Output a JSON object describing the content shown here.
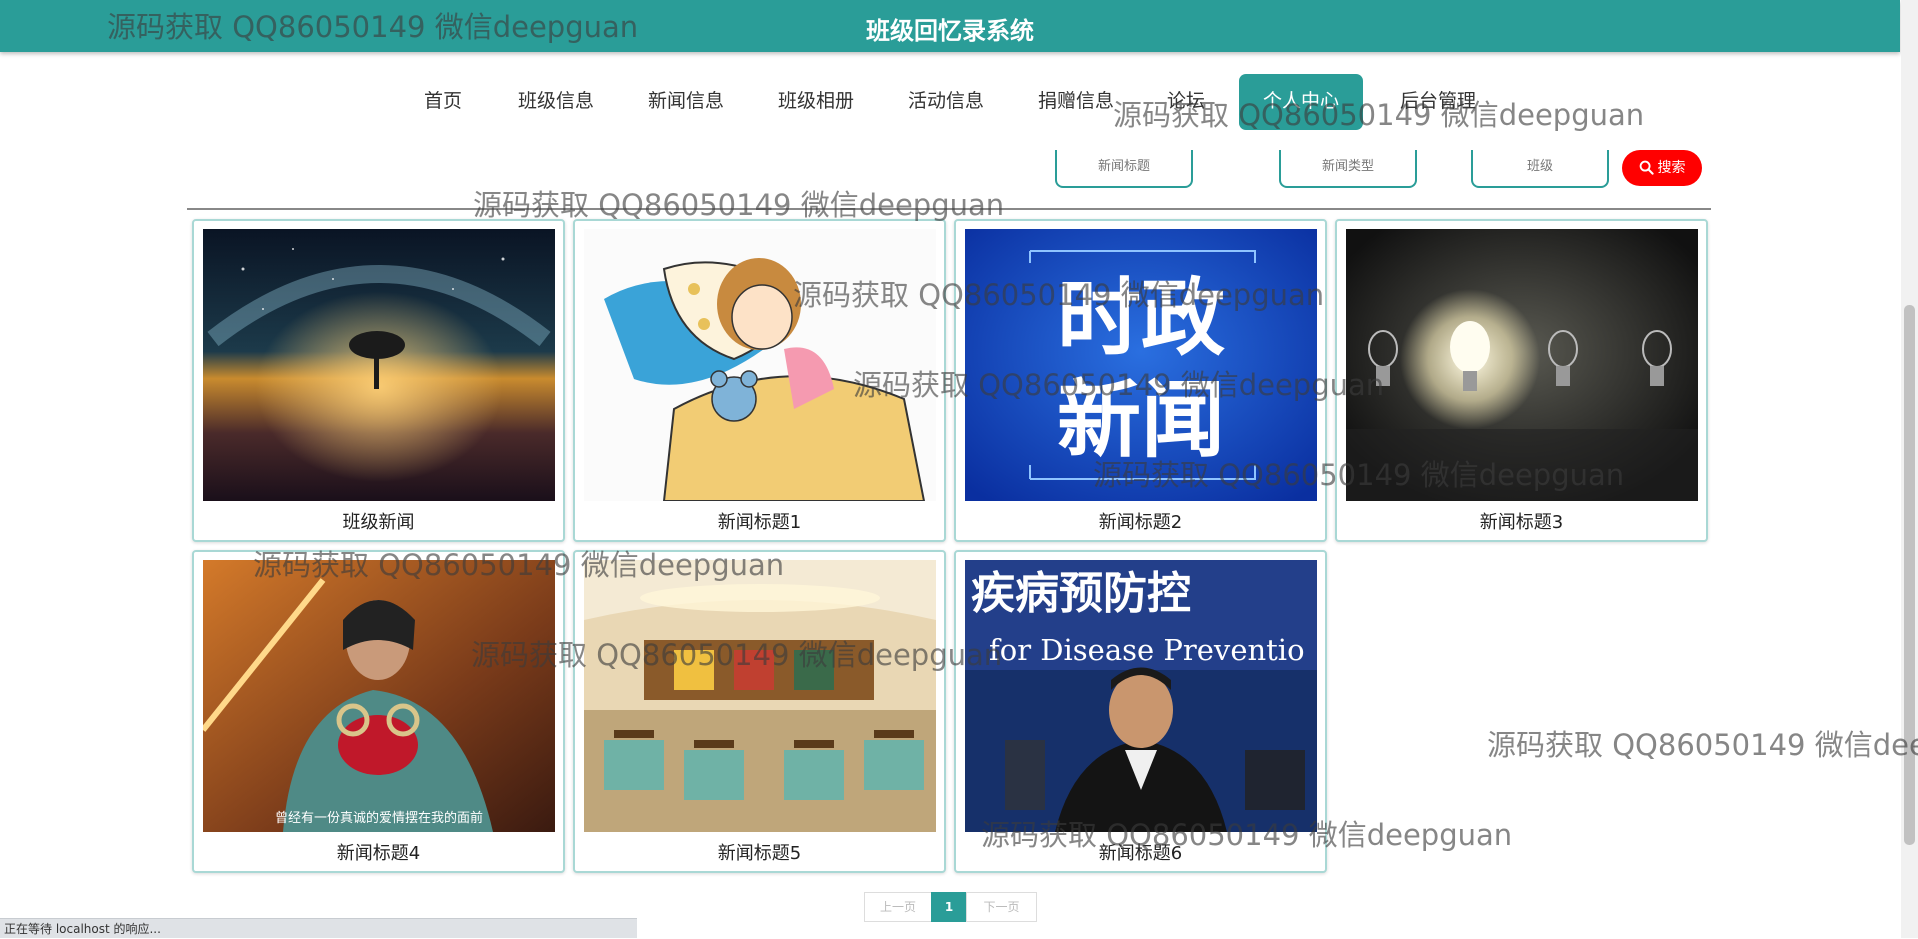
{
  "site": {
    "title": "班级回忆录系统",
    "accent": "#2a9d98"
  },
  "nav": [
    {
      "label": "首页"
    },
    {
      "label": "班级信息"
    },
    {
      "label": "新闻信息"
    },
    {
      "label": "班级相册"
    },
    {
      "label": "活动信息"
    },
    {
      "label": "捐赠信息"
    },
    {
      "label": "论坛"
    },
    {
      "label": "个人中心",
      "active": true
    },
    {
      "label": "后台管理"
    }
  ],
  "search": {
    "fields": [
      "新闻标题",
      "新闻类型",
      "班级"
    ],
    "button_label": "搜索",
    "button_color": "#ff0000"
  },
  "news": [
    {
      "title": "班级新闻",
      "image": "galaxy-tree-image"
    },
    {
      "title": "新闻标题1",
      "image": "sleeping-girl-image"
    },
    {
      "title": "新闻标题2",
      "image": "politics-news-image",
      "image_text": [
        "时政",
        "新闻"
      ]
    },
    {
      "title": "新闻标题3",
      "image": "light-bulbs-image"
    },
    {
      "title": "新闻标题4",
      "image": "movie-scene-image",
      "image_caption": "曾经有一份真诚的爱情摆在我的面前"
    },
    {
      "title": "新闻标题5",
      "image": "restaurant-image"
    },
    {
      "title": "新闻标题6",
      "image": "press-conference-image",
      "image_text": [
        "疾病预防控",
        "for Disease Preventio"
      ]
    }
  ],
  "pagination": {
    "prev": "上一页",
    "current": "1",
    "next": "下一页"
  },
  "status_bar": "正在等待 localhost 的响应...",
  "watermark": "源码获取 QQ86050149 微信deepguan"
}
